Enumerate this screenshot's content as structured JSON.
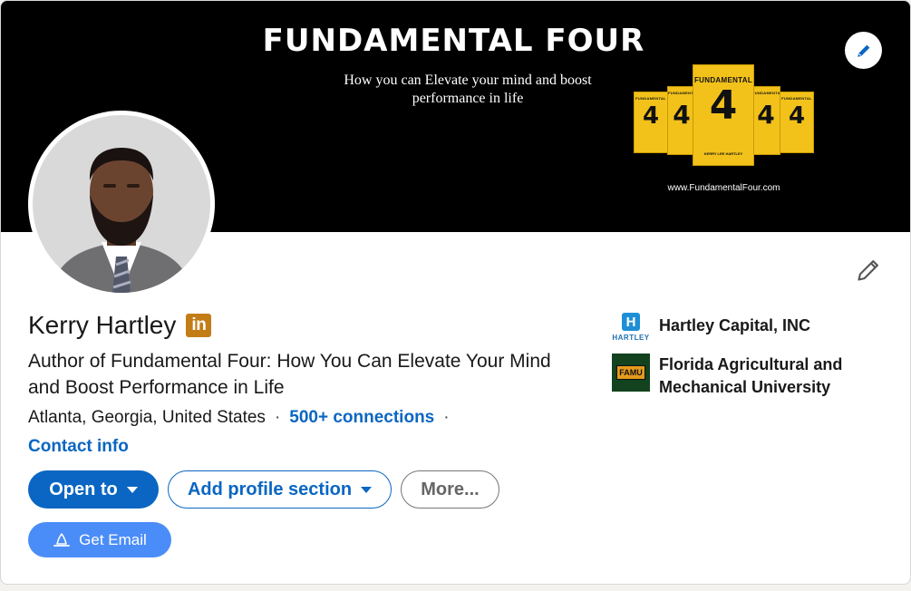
{
  "banner": {
    "title": "FUNDAMENTAL FOUR",
    "subtitle": "How you can Elevate your mind and boost performance in life",
    "url": "www.FundamentalFour.com",
    "book": {
      "title_small": "FUNDAMENTAL",
      "title_large": "FUNDAMENTAL",
      "number": "4",
      "author": "KERRY LEE HARTLEY"
    }
  },
  "profile": {
    "name": "Kerry Hartley",
    "badge": "in",
    "headline": "Author of Fundamental Four: How You Can Elevate Your Mind and Boost Performance in Life",
    "location": "Atlanta, Georgia, United States",
    "separator": "·",
    "connections": "500+ connections",
    "contact_info": "Contact info"
  },
  "actions": {
    "open_to": "Open to",
    "add_section": "Add profile section",
    "more": "More...",
    "get_email": "Get Email"
  },
  "experience": {
    "company": "Hartley Capital, INC",
    "company_logo_letter": "H",
    "company_logo_text": "HARTLEY"
  },
  "education": {
    "school": "Florida Agricultural and Mechanical University",
    "school_logo_text": "FAMU"
  },
  "icons": {
    "edit_cover": "pencil-icon",
    "edit_intro": "pencil-icon",
    "open_to_caret": "caret-down-icon",
    "add_section_caret": "caret-down-icon",
    "get_email": "bell-icon"
  },
  "colors": {
    "primary": "#0a66c2",
    "email_button": "#4b8df8",
    "badge": "#c37d16",
    "book": "#f2c21b",
    "banner": "#000000"
  }
}
